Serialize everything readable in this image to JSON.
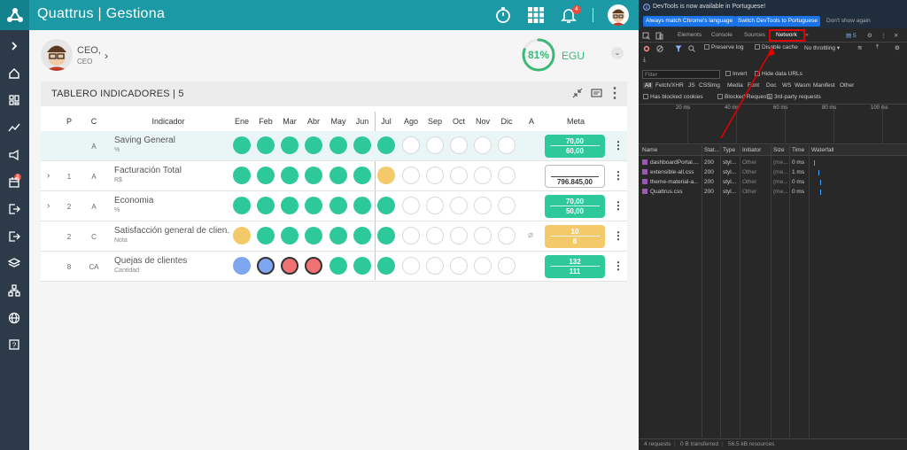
{
  "app": {
    "brand": "Quattrus | Gestiona",
    "notif_count": "4",
    "user": {
      "role": "CEO,",
      "sub": "CEO"
    },
    "gauge": {
      "value": "81%",
      "label": "EGU",
      "fraction": 0.81
    },
    "panel_title": "TABLERO INDICADORES | 5",
    "headers": {
      "p": "P",
      "c": "C",
      "indicador": "Indicador",
      "months": [
        "Ene",
        "Feb",
        "Mar",
        "Abr",
        "May",
        "Jun",
        "Jul",
        "Ago",
        "Sep",
        "Oct",
        "Nov",
        "Dic",
        "A"
      ],
      "meta": "Meta"
    },
    "rows": [
      {
        "p": "",
        "c": "A",
        "name": "Saving General",
        "unit": "%",
        "meta1": "70,00",
        "meta2": "60,00"
      },
      {
        "p": "1",
        "c": "A",
        "name": "Facturación Total",
        "unit": "R$",
        "meta1": "",
        "meta2": "796.845,00"
      },
      {
        "p": "2",
        "c": "A",
        "name": "Economia",
        "unit": "%",
        "meta1": "70,00",
        "meta2": "50,00"
      },
      {
        "p": "2",
        "c": "C",
        "name": "Satisfacción general de clien...",
        "unit": "Nota",
        "meta1": "10",
        "meta2": "8"
      },
      {
        "p": "8",
        "c": "CA",
        "name": "Quejas de clientes",
        "unit": "Cantidad",
        "meta1": "132",
        "meta2": "111"
      }
    ]
  },
  "devtools": {
    "info": "DevTools is now available in Portuguese!",
    "btn_match": "Always match Chrome's language",
    "btn_switch": "Switch DevTools to Portuguese",
    "btn_dont": "Don't show again",
    "tabs": [
      "Elements",
      "Console",
      "Sources",
      "Network"
    ],
    "issues_count": "5",
    "preserve_log": "Preserve log",
    "disable_cache": "Disable cache",
    "throttling": "No throttling",
    "filter_placeholder": "Filter",
    "invert": "Invert",
    "hide_data_urls": "Hide data URLs",
    "types": [
      "All",
      "Fetch/XHR",
      "JS",
      "CSS",
      "Img",
      "Media",
      "Font",
      "Doc",
      "WS",
      "Wasm",
      "Manifest",
      "Other"
    ],
    "blocked_cookies": "Has blocked cookies",
    "blocked_requests": "Blocked Requests",
    "third_party": "3rd-party requests",
    "timeline_labels": [
      "20 ms",
      "40 ms",
      "60 ms",
      "80 ms",
      "100 ms"
    ],
    "columns": [
      "Name",
      "Stat...",
      "Type",
      "Initiator",
      "Size",
      "Time",
      "Waterfall"
    ],
    "requests": [
      {
        "name": "dashboardPortal....",
        "status": "200",
        "type": "styl...",
        "initiator": "Other",
        "size": "(me...",
        "time": "0 ms"
      },
      {
        "name": "extensible-all.css",
        "status": "200",
        "type": "styl...",
        "initiator": "Other",
        "size": "(me...",
        "time": "1 ms"
      },
      {
        "name": "theme-material-a...",
        "status": "200",
        "type": "styl...",
        "initiator": "Other",
        "size": "(me...",
        "time": "0 ms"
      },
      {
        "name": "Quattrus.css",
        "status": "200",
        "type": "styl...",
        "initiator": "Other",
        "size": "(me...",
        "time": "0 ms"
      }
    ],
    "summary": {
      "requests": "4 requests",
      "transferred": "0 B transferred",
      "resources": "56.5 kB resources"
    }
  },
  "colors": {
    "teal": "#1b9aa6",
    "green": "#2ec99a",
    "yellow": "#f3c969",
    "red": "#f07272",
    "blue": "#7ea5f0"
  }
}
